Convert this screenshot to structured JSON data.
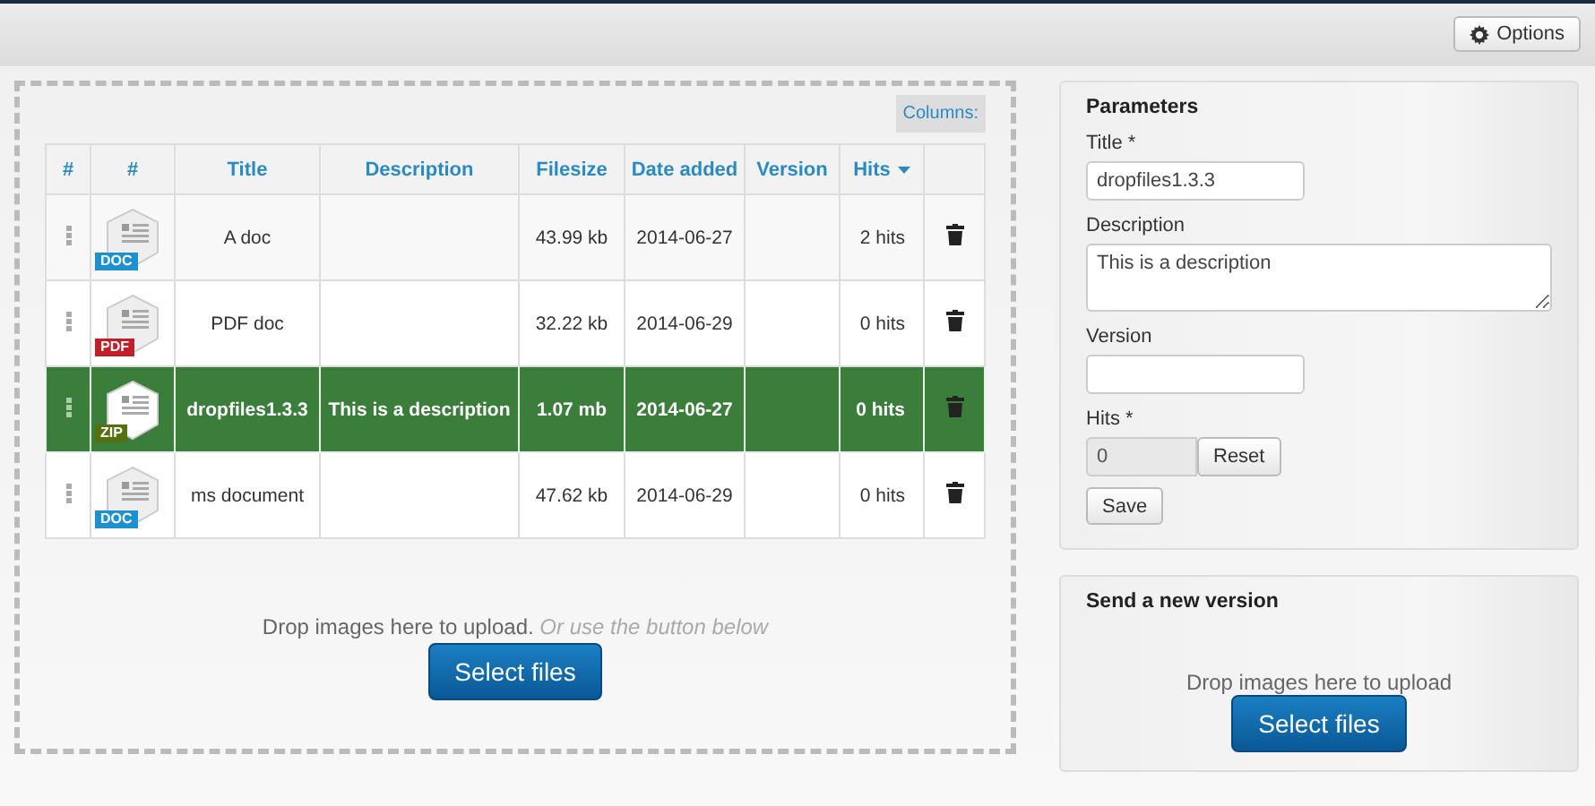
{
  "toolbar": {
    "options_button": "Options"
  },
  "table": {
    "columns_button": "Columns:",
    "columns": [
      {
        "label": "#",
        "sorted": false
      },
      {
        "label": "#",
        "sorted": false
      },
      {
        "label": "Title",
        "sorted": false
      },
      {
        "label": "Description",
        "sorted": false
      },
      {
        "label": "Filesize",
        "sorted": false
      },
      {
        "label": "Date added",
        "sorted": false
      },
      {
        "label": "Version",
        "sorted": false
      },
      {
        "label": "Hits",
        "sorted": true
      }
    ],
    "rows": [
      {
        "badge": "DOC",
        "color": "#1e90d0",
        "title": "A doc",
        "description": "",
        "filesize": "43.99 kb",
        "date": "2014-06-27",
        "version": "",
        "hits": "2 hits",
        "selected": false
      },
      {
        "badge": "PDF",
        "color": "#c0202a",
        "title": "PDF doc",
        "description": "",
        "filesize": "32.22 kb",
        "date": "2014-06-29",
        "version": "",
        "hits": "0 hits",
        "selected": false
      },
      {
        "badge": "ZIP",
        "color": "#557010",
        "title": "dropfiles1.3.3",
        "description": "This is a description",
        "filesize": "1.07 mb",
        "date": "2014-06-27",
        "version": "",
        "hits": "0 hits",
        "selected": true
      },
      {
        "badge": "DOC",
        "color": "#1e90d0",
        "title": "ms document",
        "description": "",
        "filesize": "47.62 kb",
        "date": "2014-06-29",
        "version": "",
        "hits": "0 hits",
        "selected": false
      }
    ]
  },
  "upload": {
    "text": "Drop images here to upload.",
    "hint": "Or use the button below",
    "button": "Select files"
  },
  "parameters": {
    "heading": "Parameters",
    "title_label": "Title *",
    "title_value": "dropfiles1.3.3",
    "description_label": "Description",
    "description_value": "This is a description",
    "version_label": "Version",
    "hits_label": "Hits *",
    "hits_value": "0",
    "reset_button": "Reset",
    "save_button": "Save"
  },
  "new_version": {
    "heading": "Send a new version",
    "text": "Drop images here to upload",
    "button": "Select files"
  }
}
